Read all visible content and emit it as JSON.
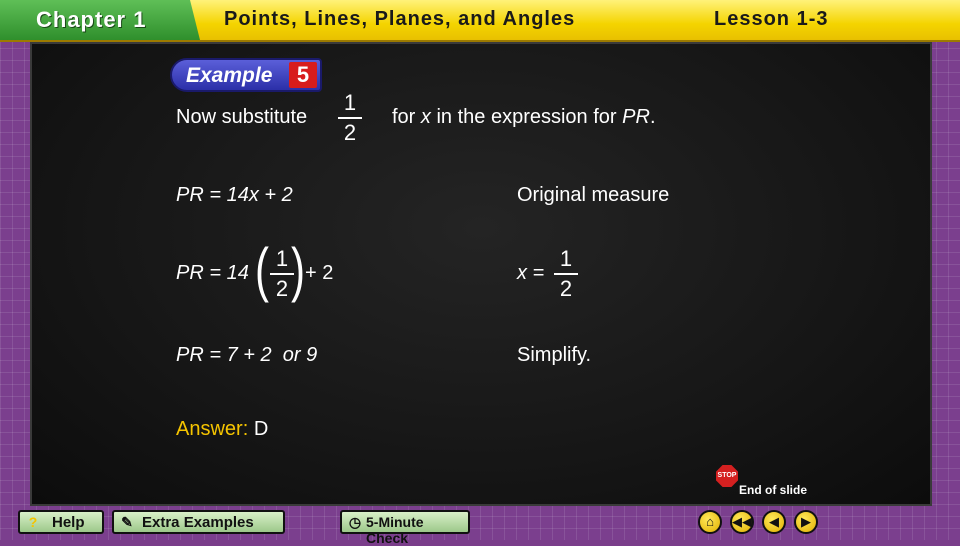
{
  "header": {
    "chapter": "Chapter 1",
    "title": "Points, Lines, Planes, and Angles",
    "lesson": "Lesson 1-3"
  },
  "example": {
    "label": "Example",
    "number": "5"
  },
  "instruction": {
    "prefix": "Now substitute",
    "frac_num": "1",
    "frac_den": "2",
    "suffix_pre": "for",
    "var": "x",
    "suffix_mid": "in the expression for",
    "target": "PR",
    "suffix_end": "."
  },
  "steps": [
    {
      "expr": "PR = 14x + 2",
      "note": "Original measure"
    },
    {
      "expr_lhs": "PR = 14",
      "frac_num": "1",
      "frac_den": "2",
      "expr_rhs": "+ 2",
      "note_lhs": "x =",
      "note_num": "1",
      "note_den": "2"
    },
    {
      "expr": "PR = 7 + 2  or 9",
      "note": "Simplify."
    }
  ],
  "answer": {
    "label": "Answer:",
    "value": "D"
  },
  "end_slide": {
    "stop": "STOP",
    "label": "End of slide"
  },
  "toolbar": {
    "help": "Help",
    "extra_examples": "Extra Examples",
    "five_minute_check": "5-Minute Check"
  },
  "icons": {
    "help": "question-icon",
    "extra": "tutor-icon",
    "check": "clock-icon",
    "home": "home-icon",
    "first": "first-icon",
    "prev": "previous-icon",
    "next": "next-icon"
  },
  "colors": {
    "header": "#f4d400",
    "chapter_tab": "#2f8f2c",
    "answer_label": "#f5c400",
    "example_badge": "#2b2fa8",
    "example_number": "#d81c1c"
  }
}
